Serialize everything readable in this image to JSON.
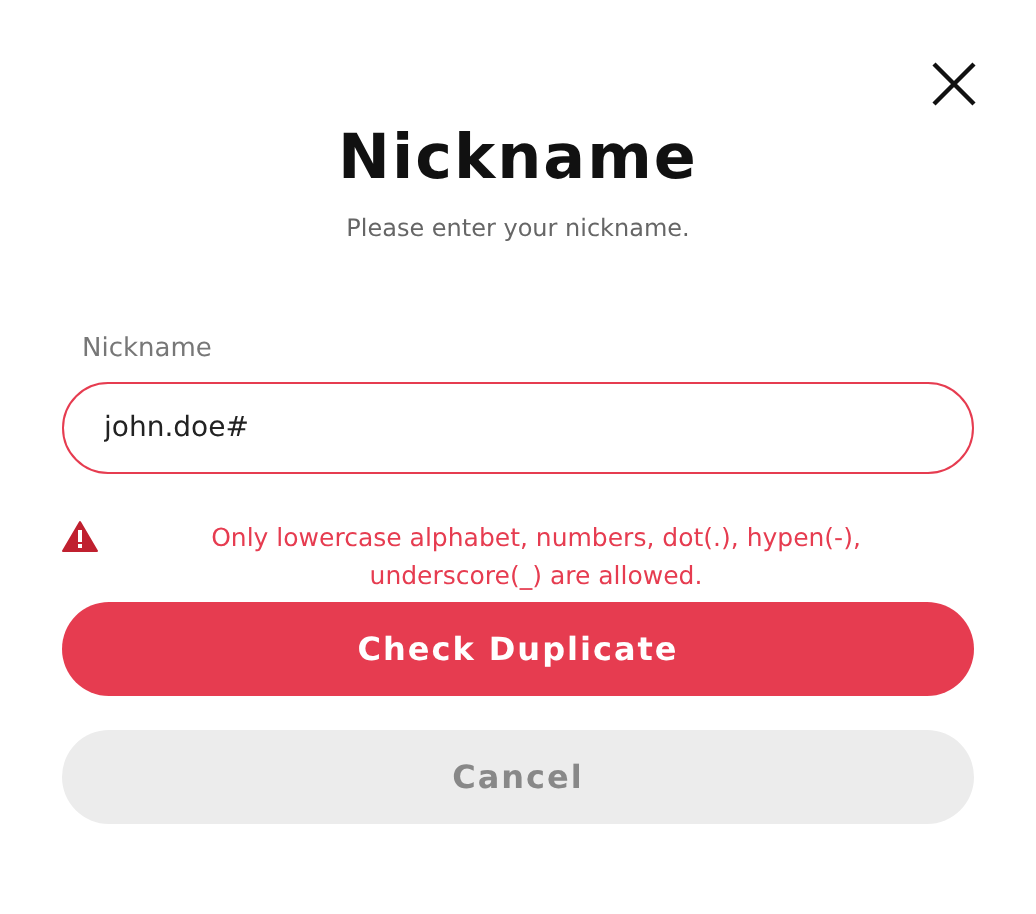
{
  "dialog": {
    "title": "Nickname",
    "subtitle": "Please enter your nickname."
  },
  "field": {
    "label": "Nickname",
    "value": "john.doe#",
    "invalid": true,
    "error": "Only lowercase alphabet, numbers, dot(.), hypen(-), underscore(_) are allowed."
  },
  "buttons": [
    {
      "label": "Check Duplicate",
      "kind": "primary"
    },
    {
      "label": "Cancel",
      "kind": "secondary"
    }
  ]
}
